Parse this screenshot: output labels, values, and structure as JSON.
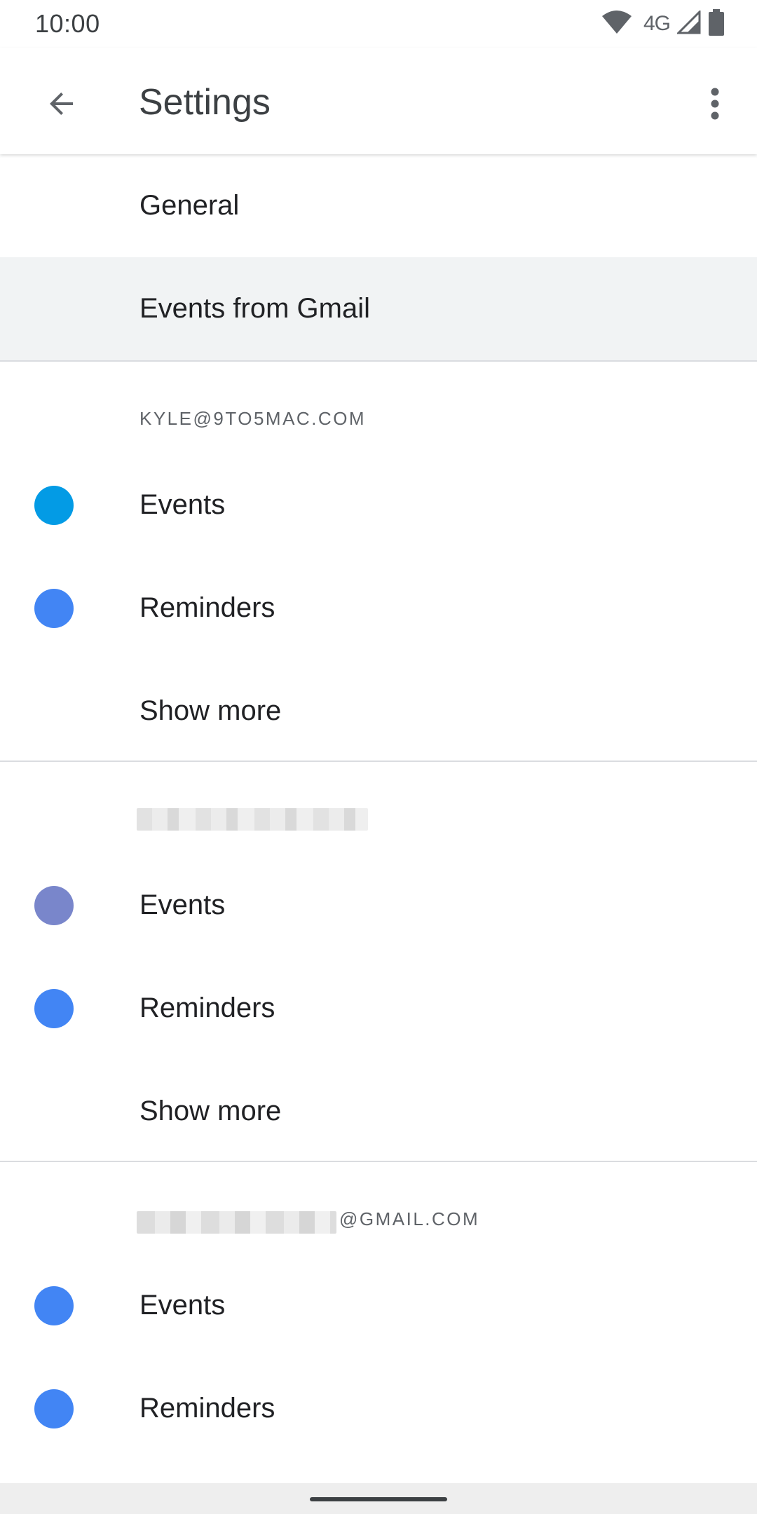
{
  "status_bar": {
    "time": "10:00",
    "network": "4G",
    "icons": [
      "wifi-icon",
      "cell-signal-icon",
      "battery-icon"
    ]
  },
  "app_bar": {
    "title": "Settings",
    "back_icon": "arrow-back-icon",
    "more_icon": "more-vert-icon"
  },
  "menu": {
    "general": "General",
    "events_from_gmail": "Events from Gmail"
  },
  "accounts": [
    {
      "header": "KYLE@9TO5MAC.COM",
      "items": [
        {
          "label": "Events",
          "color": "#039be5"
        },
        {
          "label": "Reminders",
          "color": "#4285f4"
        }
      ],
      "show_more": "Show more"
    },
    {
      "header": "",
      "items": [
        {
          "label": "Events",
          "color": "#7986cb"
        },
        {
          "label": "Reminders",
          "color": "#4285f4"
        }
      ],
      "show_more": "Show more"
    },
    {
      "header_suffix": "@GMAIL.COM",
      "items": [
        {
          "label": "Events",
          "color": "#4285f4"
        },
        {
          "label": "Reminders",
          "color": "#4285f4"
        }
      ]
    }
  ]
}
